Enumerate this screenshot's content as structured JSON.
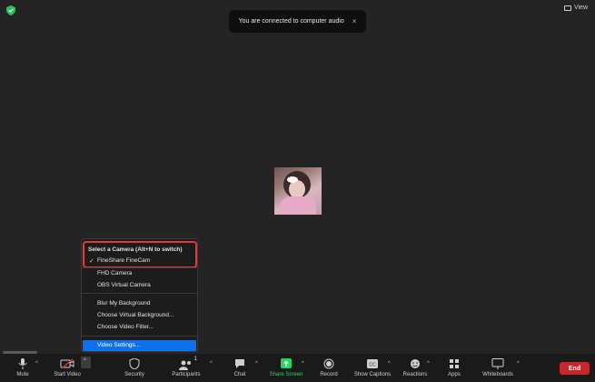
{
  "toast": {
    "message": "You are connected to computer audio",
    "close": "×"
  },
  "header": {
    "view_label": "View"
  },
  "camera_menu": {
    "header": "Select a Camera (Alt+N to switch)",
    "check_mark": "✓",
    "items": [
      "FineShare FineCam",
      "FHD Camera",
      "OBS Virtual Camera"
    ],
    "selected_index": 0,
    "background_items": [
      "Blur My Background",
      "Choose Virtual Background...",
      "Choose Video Filter..."
    ],
    "settings": "Video Settings..."
  },
  "toolbar": {
    "mute": "Mute",
    "start_video": "Start Video",
    "security": "Security",
    "participants": "Participants",
    "participants_count": "1",
    "chat": "Chat",
    "share_screen": "Share Screen",
    "record": "Record",
    "show_captions": "Show Captions",
    "reactions": "Reactions",
    "apps": "Apps",
    "whiteboards": "Whiteboards",
    "end": "End",
    "caret": "^"
  },
  "colors": {
    "accent": "#0e71eb",
    "end": "#c8262d",
    "share": "#23d959",
    "highlight": "#e0393e",
    "shield": "#2bbf5a"
  }
}
